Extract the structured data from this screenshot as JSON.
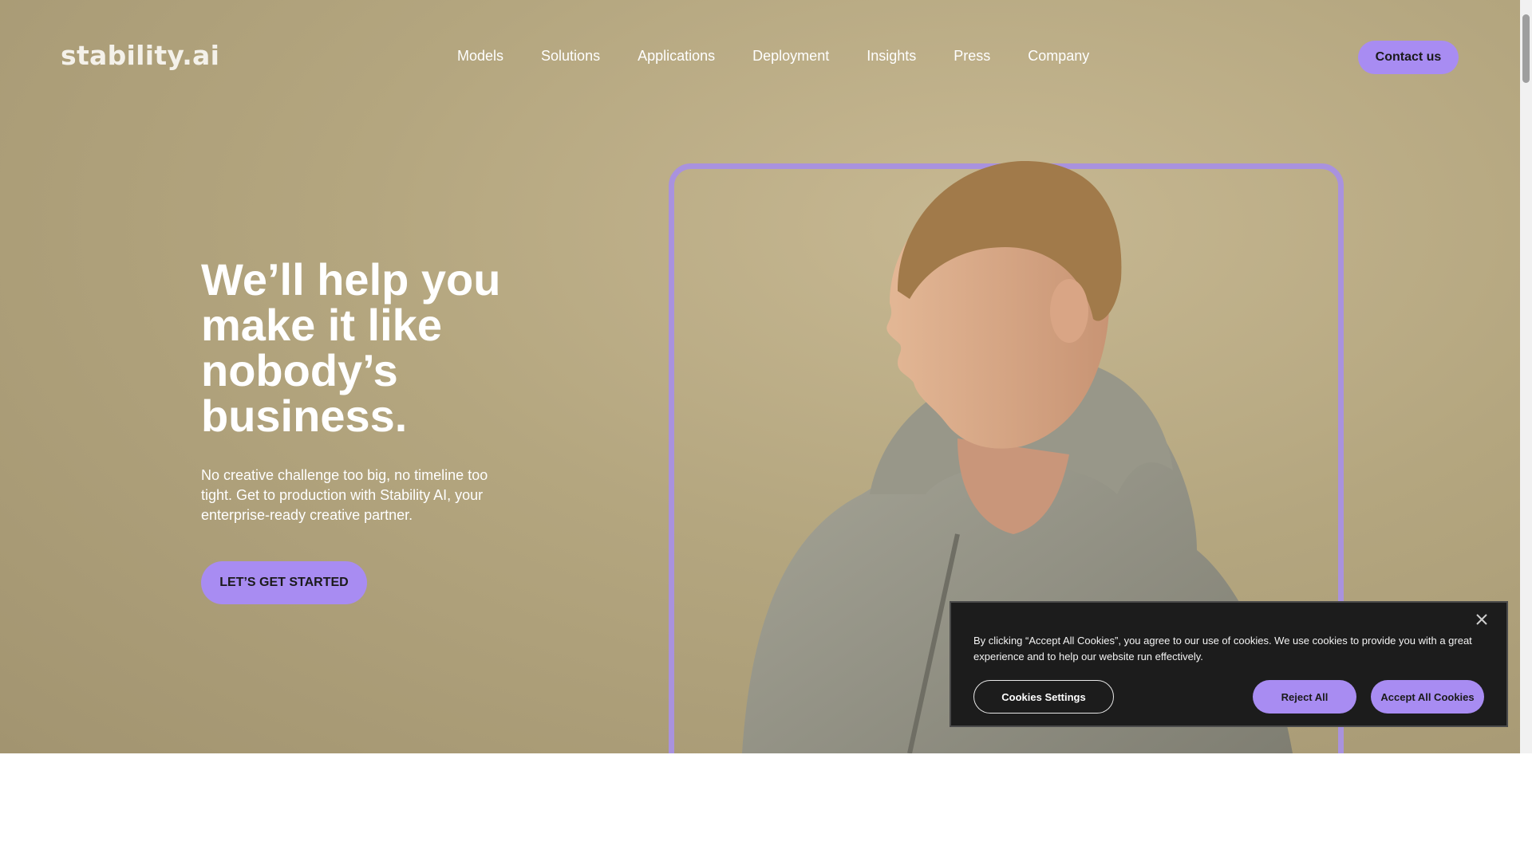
{
  "header": {
    "logo": "stability.ai",
    "nav": [
      "Models",
      "Solutions",
      "Applications",
      "Deployment",
      "Insights",
      "Press",
      "Company"
    ],
    "contact_label": "Contact us"
  },
  "hero": {
    "headline": "We’ll help you make it like nobody’s business.",
    "subtext": "No creative challenge too big, no timeline too tight. Get to production with Stability AI, your enterprise-ready creative partner.",
    "cta_label": "LET’S GET STARTED"
  },
  "cookie_banner": {
    "text": "By clicking “Accept All Cookies”, you agree to our use of cookies. We use cookies to provide you with a great experience and to help our website run effectively.",
    "settings_label": "Cookies Settings",
    "reject_label": "Reject All",
    "accept_label": "Accept All Cookies"
  },
  "colors": {
    "accent": "#a88cf2",
    "hero_background": "#b4a67f",
    "banner_background": "#1c1c1c"
  }
}
